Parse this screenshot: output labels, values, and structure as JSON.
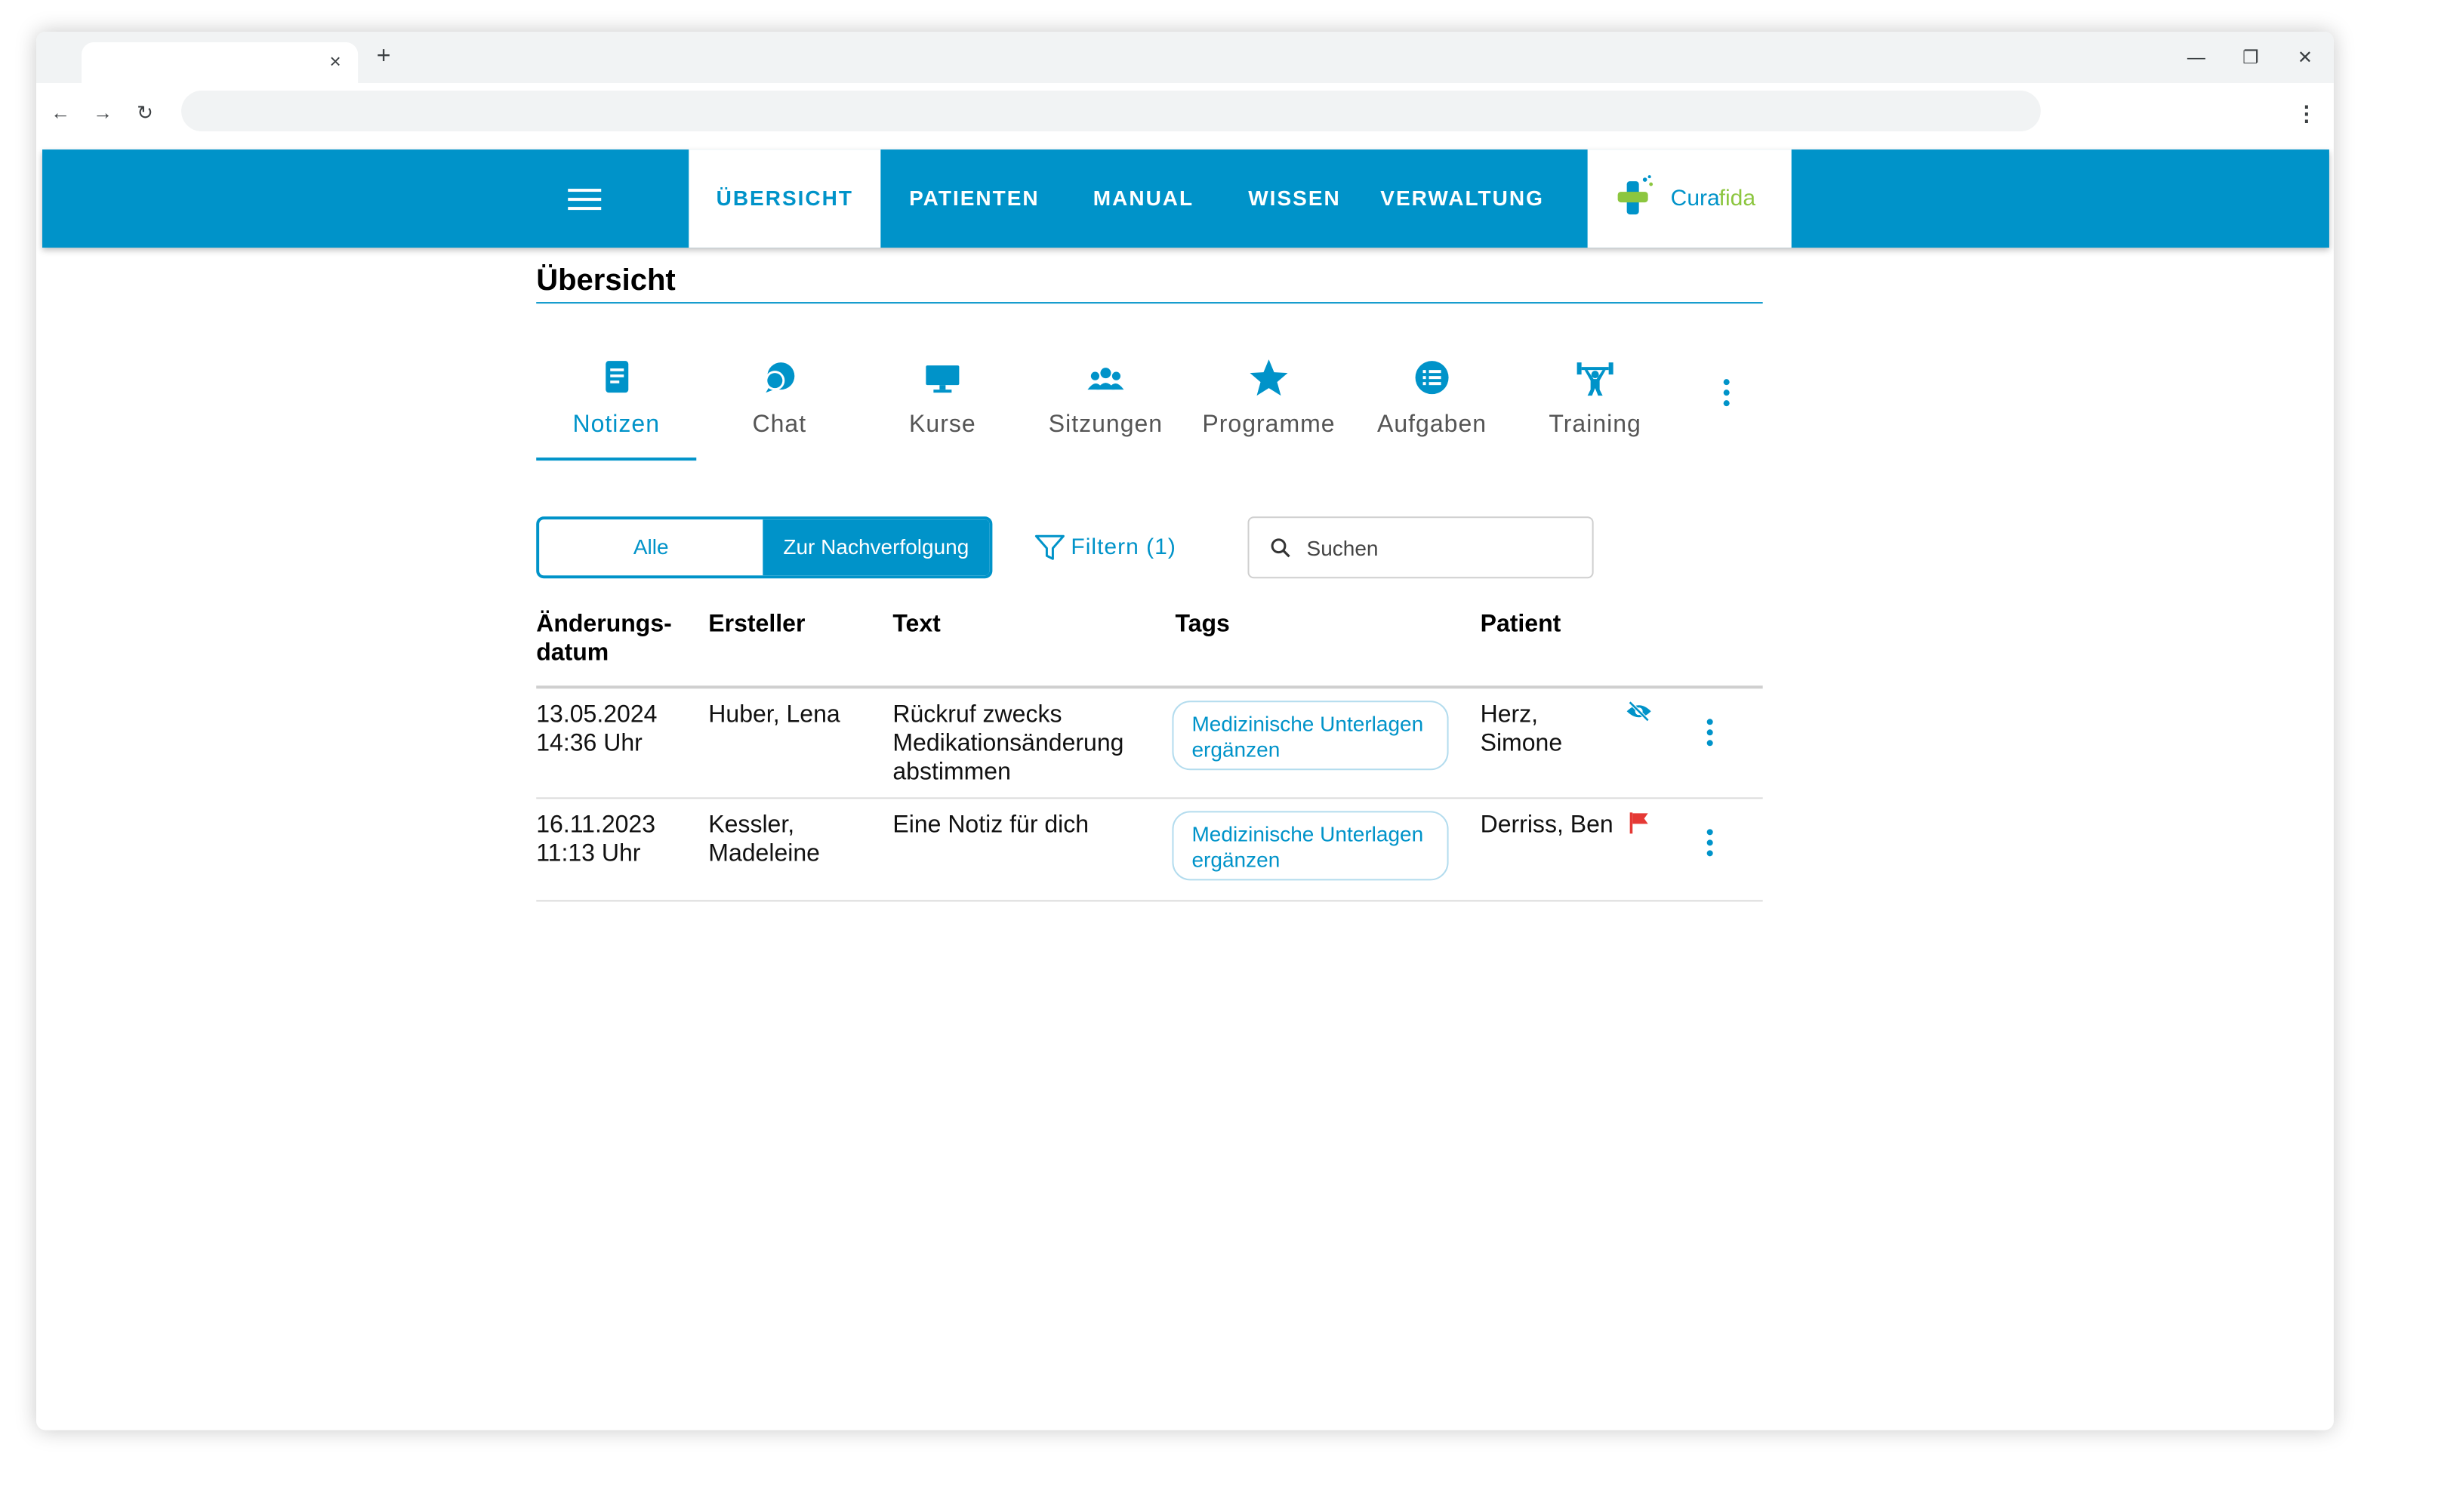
{
  "browser": {
    "tab_close": "×",
    "new_tab": "+",
    "back": "←",
    "forward": "→",
    "reload": "↻",
    "minimize": "—",
    "restore": "❐",
    "close": "✕",
    "menu": "⋮"
  },
  "nav": {
    "items": [
      {
        "label": "ÜBERSICHT"
      },
      {
        "label": "PATIENTEN"
      },
      {
        "label": "MANUAL"
      },
      {
        "label": "WISSEN"
      },
      {
        "label": "VERWALTUNG"
      }
    ],
    "logo": {
      "part1": "Cura",
      "part2": "fida"
    }
  },
  "colors": {
    "primary": "#0093c9",
    "logo_green": "#8cc63f",
    "flag_red": "#e53935"
  },
  "page": {
    "title": "Übersicht"
  },
  "tabs": [
    {
      "label": "Notizen",
      "icon": "note-icon"
    },
    {
      "label": "Chat",
      "icon": "chat-icon"
    },
    {
      "label": "Kurse",
      "icon": "monitor-icon"
    },
    {
      "label": "Sitzungen",
      "icon": "group-icon"
    },
    {
      "label": "Programme",
      "icon": "star-icon"
    },
    {
      "label": "Aufgaben",
      "icon": "list-icon"
    },
    {
      "label": "Training",
      "icon": "weightlifting-icon"
    }
  ],
  "filters": {
    "all_label": "Alle",
    "follow_up_label": "Zur Nachverfolgung",
    "filter_label": "Filtern (1)",
    "search_placeholder": "Suchen"
  },
  "table": {
    "headers": {
      "date_line1": "Änderungs-",
      "date_line2": "datum",
      "creator": "Ersteller",
      "text": "Text",
      "tags": "Tags",
      "patient": "Patient"
    },
    "rows": [
      {
        "date": "13.05.2024",
        "time": "14:36 Uhr",
        "creator_line1": "Huber, Lena",
        "creator_line2": "",
        "text_line1": "Rückruf zwecks",
        "text_line2": "Medikationsänderung",
        "text_line3": "abstimmen",
        "tag_line1": "Medizinische Unterlagen",
        "tag_line2": "ergänzen",
        "patient_line1": "Herz,",
        "patient_line2": "Simone",
        "status_icon": "eye-off-icon"
      },
      {
        "date": "16.11.2023",
        "time": "11:13 Uhr",
        "creator_line1": "Kessler,",
        "creator_line2": "Madeleine",
        "text_line1": "Eine Notiz für dich",
        "text_line2": "",
        "text_line3": "",
        "tag_line1": "Medizinische Unterlagen",
        "tag_line2": "ergänzen",
        "patient_line1": "Derriss, Ben",
        "patient_line2": "",
        "status_icon": "flag-icon"
      }
    ]
  }
}
